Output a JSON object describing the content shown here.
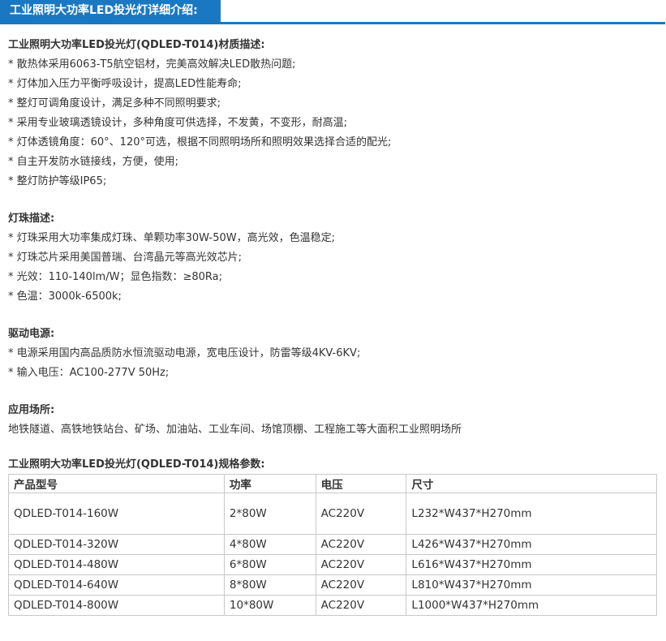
{
  "header": {
    "title": "工业照明大功率LED投光灯详细介绍:"
  },
  "sections": [
    {
      "title": "工业照明大功率LED投光灯(QDLED-T014)材质描述:",
      "items": [
        "* 散热体采用6063-T5航空铝材，完美高效解决LED散热问题;",
        "* 灯体加入压力平衡呼吸设计，提高LED性能寿命;",
        "* 整灯可调角度设计，满足多种不同照明要求;",
        "* 采用专业玻璃透镜设计，多种角度可供选择，不发黄，不变形，耐高温;",
        "* 灯体透镜角度：60°、120°可选，根据不同照明场所和照明效果选择合适的配光;",
        "* 自主开发防水链接线，方便，使用;",
        "* 整灯防护等级IP65;"
      ]
    },
    {
      "title": "灯珠描述:",
      "items": [
        "* 灯珠采用大功率集成灯珠、单颗功率30W-50W，高光效，色温稳定;",
        "* 灯珠芯片采用美国普瑞、台湾晶元等高光效芯片;",
        "* 光效：110-140lm/W；显色指数：≥80Ra;",
        "* 色温：3000k-6500k;"
      ]
    },
    {
      "title": "驱动电源:",
      "items": [
        "* 电源采用国内高品质防水恒流驱动电源，宽电压设计，防雷等级4KV-6KV;",
        "* 输入电压：AC100-277V 50Hz;"
      ]
    },
    {
      "title": "应用场所:",
      "items": [
        "地铁隧道、高铁地铁站台、矿场、加油站、工业车间、场馆顶棚、工程施工等大面积工业照明场所"
      ]
    }
  ],
  "spec": {
    "title": "工业照明大功率LED投光灯(QDLED-T014)规格参数:",
    "headers": [
      "产品型号",
      "功率",
      "电压",
      "尺寸"
    ],
    "rows": [
      [
        "QDLED-T014-160W",
        "2*80W",
        "AC220V",
        "L232*W437*H270mm"
      ],
      [
        "QDLED-T014-320W",
        "4*80W",
        "AC220V",
        "L426*W437*H270mm"
      ],
      [
        "QDLED-T014-480W",
        "6*80W",
        "AC220V",
        "L616*W437*H270mm"
      ],
      [
        "QDLED-T014-640W",
        "8*80W",
        "AC220V",
        "L810*W437*H270mm"
      ],
      [
        "QDLED-T014-800W",
        "10*80W",
        "AC220V",
        "L1000*W437*H270mm"
      ]
    ]
  },
  "colors": {
    "accent": "#1a78c2",
    "text": "#333333",
    "border": "#c8c8c8"
  }
}
